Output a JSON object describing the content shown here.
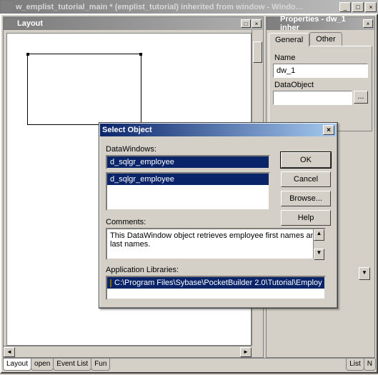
{
  "titlebar": {
    "text": "w_emplist_tutorial_main * (emplist_tutorial) inherited from window - Windo…"
  },
  "layout_panel": {
    "title": "Layout"
  },
  "properties_panel": {
    "title": "Properties - dw_1 inher",
    "tabs": {
      "general": "General",
      "other": "Other"
    },
    "name_label": "Name",
    "name_value": "dw_1",
    "dataobject_label": "DataObject",
    "dots": "..."
  },
  "dialog": {
    "title": "Select Object",
    "dw_label": "DataWindows:",
    "dw_input": "d_sqlgr_employee",
    "dw_list_item": "d_sqlgr_employee",
    "comments_label": "Comments:",
    "comments_text": "This DataWindow object retrieves employee first names and last names.",
    "libs_label": "Application Libraries:",
    "libs_item": "C:\\Program Files\\Sybase\\PocketBuilder 2.0\\Tutorial\\Employ",
    "buttons": {
      "ok": "OK",
      "cancel": "Cancel",
      "browse": "Browse...",
      "help": "Help"
    }
  },
  "bottom_tabs": {
    "t1": "Layout",
    "t2": "open",
    "t3": "Event List",
    "t4": "Fun",
    "t5": "List",
    "t6": "N"
  }
}
